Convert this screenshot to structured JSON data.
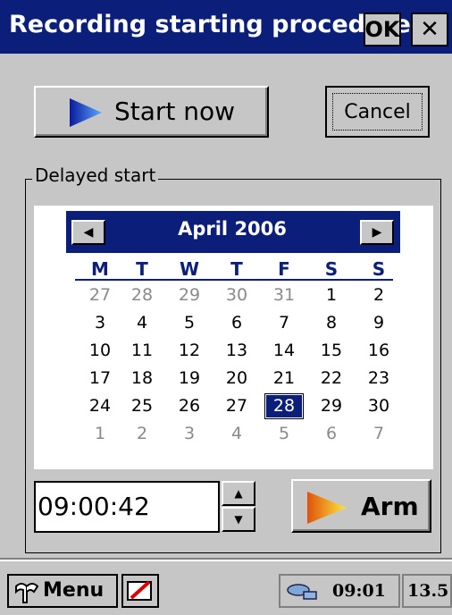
{
  "window": {
    "title": "Recording starting procedure",
    "ok_label": "OK",
    "close_label": "✕"
  },
  "buttons": {
    "start_now": "Start now",
    "cancel": "Cancel",
    "arm": "Arm"
  },
  "group": {
    "label": "Delayed start"
  },
  "calendar": {
    "month_title": "April 2006",
    "weekdays": [
      "M",
      "T",
      "W",
      "T",
      "F",
      "S",
      "S"
    ],
    "weeks": [
      [
        {
          "d": "27",
          "o": true
        },
        {
          "d": "28",
          "o": true
        },
        {
          "d": "29",
          "o": true
        },
        {
          "d": "30",
          "o": true
        },
        {
          "d": "31",
          "o": true
        },
        {
          "d": "1"
        },
        {
          "d": "2"
        }
      ],
      [
        {
          "d": "3"
        },
        {
          "d": "4"
        },
        {
          "d": "5"
        },
        {
          "d": "6"
        },
        {
          "d": "7"
        },
        {
          "d": "8"
        },
        {
          "d": "9"
        }
      ],
      [
        {
          "d": "10"
        },
        {
          "d": "11"
        },
        {
          "d": "12"
        },
        {
          "d": "13"
        },
        {
          "d": "14"
        },
        {
          "d": "15"
        },
        {
          "d": "16"
        }
      ],
      [
        {
          "d": "17"
        },
        {
          "d": "18"
        },
        {
          "d": "19"
        },
        {
          "d": "20"
        },
        {
          "d": "21"
        },
        {
          "d": "22"
        },
        {
          "d": "23"
        }
      ],
      [
        {
          "d": "24"
        },
        {
          "d": "25"
        },
        {
          "d": "26"
        },
        {
          "d": "27"
        },
        {
          "d": "28",
          "sel": true
        },
        {
          "d": "29"
        },
        {
          "d": "30"
        }
      ],
      [
        {
          "d": "1",
          "o": true
        },
        {
          "d": "2",
          "o": true
        },
        {
          "d": "3",
          "o": true
        },
        {
          "d": "4",
          "o": true
        },
        {
          "d": "5",
          "o": true
        },
        {
          "d": "6",
          "o": true
        },
        {
          "d": "7",
          "o": true
        }
      ]
    ]
  },
  "time": {
    "value": "09:00:42"
  },
  "taskbar": {
    "menu_label": "Menu",
    "clock": "09:01",
    "battery": "13.5"
  },
  "colors": {
    "title_bar": "#0b1f7a",
    "face": "#c6c6c6",
    "selected_day": "#0b1f7a"
  }
}
